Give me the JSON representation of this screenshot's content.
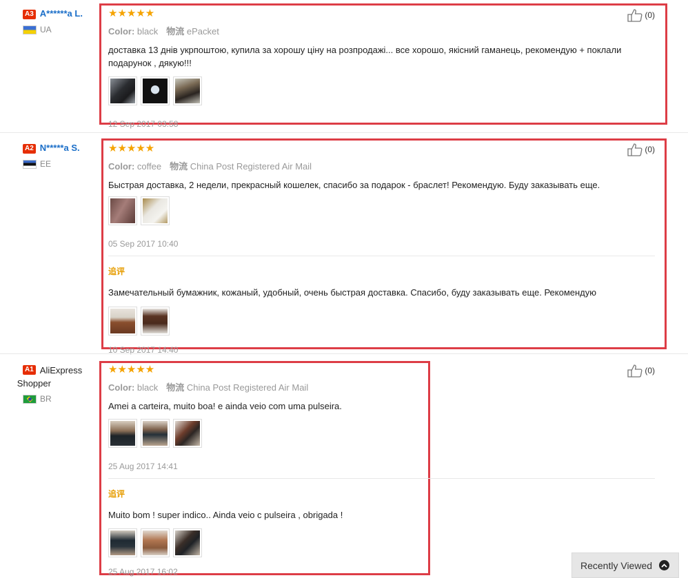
{
  "reviews": [
    {
      "badge": "A3",
      "name": "A******a L.",
      "country": "UA",
      "stars": "★★★★★",
      "color_label": "Color:",
      "color_value": "black",
      "shipping_label": "物流",
      "shipping_value": "ePacket",
      "text": "доставка 13 днів укрпоштою, купила за хорошу ціну на розпродажі... все хорошо, якісний гаманець, рекомендую + поклали подарунок , дякую!!!",
      "date": "12 Sep 2017 03:58",
      "likes": "(0)"
    },
    {
      "badge": "A2",
      "name": "N*****a S.",
      "country": "EE",
      "stars": "★★★★★",
      "color_label": "Color:",
      "color_value": "coffee",
      "shipping_label": "物流",
      "shipping_value": "China Post Registered Air Mail",
      "text": "Быстрая доставка, 2 недели, прекрасный кошелек, спасибо за подарок - браслет! Рекомендую. Буду заказывать еще.",
      "date": "05 Sep 2017 10:40",
      "followup_label": "追评",
      "followup_text": "Замечательный бумажник, кожаный, удобный, очень быстрая доставка. Спасибо, буду заказывать еще. Рекомендую",
      "followup_date": "10 Sep 2017 14:40",
      "likes": "(0)"
    },
    {
      "badge": "A1",
      "name": "AliExpress Shopper",
      "country": "BR",
      "stars": "★★★★★",
      "color_label": "Color:",
      "color_value": "black",
      "shipping_label": "物流",
      "shipping_value": "China Post Registered Air Mail",
      "text": "Amei a carteira, muito boa! e ainda veio com uma pulseira.",
      "date": "25 Aug 2017 14:41",
      "followup_label": "追评",
      "followup_text": "Muito bom ! super indico.. Ainda veio c pulseira , obrigada !",
      "followup_date": "25 Aug 2017 16:02",
      "likes": "(0)"
    }
  ],
  "recently_viewed": "Recently Viewed",
  "colors": {
    "highlight": "#dd3d46",
    "star": "#f5a300",
    "badge": "#e62e04",
    "followup": "#e69c00",
    "link": "#1a6ec8"
  }
}
